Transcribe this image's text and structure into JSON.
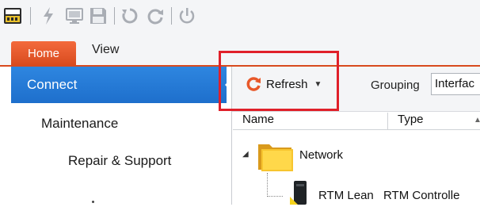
{
  "quick_access": {
    "icons": [
      "app-logo-icon",
      "flash-icon",
      "monitor-icon",
      "save-icon",
      "restart-icon",
      "refresh-circle-icon",
      "power-icon"
    ]
  },
  "ribbon": {
    "tabs": [
      {
        "label": "Home",
        "active": true
      },
      {
        "label": "View",
        "active": false
      }
    ],
    "accent": "#e8582a"
  },
  "sidebar": {
    "items": [
      {
        "label": "Connect",
        "selected": true
      },
      {
        "label": "Maintenance",
        "selected": false
      },
      {
        "label": "Repair & Support",
        "selected": false
      }
    ],
    "selected_color": "#2577d6"
  },
  "toolbar": {
    "refresh_label": "Refresh",
    "grouping_label": "Grouping",
    "grouping_value": "Interfac"
  },
  "columns": [
    "Name",
    "Type"
  ],
  "tree": {
    "root": {
      "label": "Network",
      "expanded": true
    },
    "children": [
      {
        "name": "RTM Lean",
        "type": "RTM Controlle"
      }
    ]
  },
  "highlight_color": "#e0202a"
}
